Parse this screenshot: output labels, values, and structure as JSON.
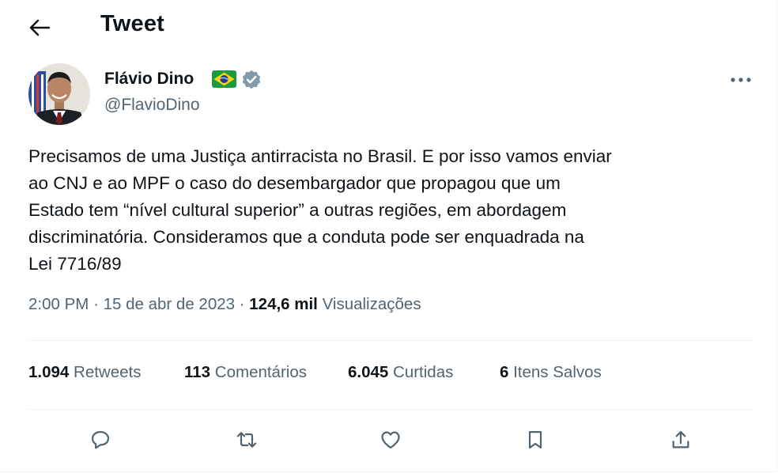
{
  "header": {
    "title": "Tweet",
    "back_icon": "arrow-left-icon"
  },
  "author": {
    "name": "Flávio Dino",
    "handle": "@FlavioDino",
    "flag_icon": "brazil-flag-icon",
    "verified_icon": "verified-badge-icon",
    "verified_color": "#829aab",
    "more_icon": "more-horizontal-icon"
  },
  "tweet": {
    "text_lines": [
      "Precisamos de uma Justiça antirracista no Brasil. E por isso vamos enviar",
      "ao CNJ e ao MPF o caso do desembargador que propagou que um",
      "Estado tem “nível cultural superior” a outras regiões, em abordagem",
      "discriminatória. Consideramos que a conduta pode ser enquadrada na",
      "Lei 7716/89"
    ],
    "time": "2:00 PM",
    "separator": "·",
    "date": "15 de abr de 2023",
    "views_count": "124,6 mil",
    "views_label": "Visualizações"
  },
  "stats": {
    "retweets": {
      "count": "1.094",
      "label": "Retweets"
    },
    "comments": {
      "count": "113",
      "label": "Comentários"
    },
    "likes": {
      "count": "6.045",
      "label": "Curtidas"
    },
    "saved": {
      "count": "6",
      "label": "Itens Salvos"
    }
  },
  "actions": {
    "reply_icon": "reply-icon",
    "retweet_icon": "retweet-icon",
    "like_icon": "heart-icon",
    "bookmark_icon": "bookmark-icon",
    "share_icon": "share-icon"
  },
  "colors": {
    "text_primary": "#0f1419",
    "text_secondary": "#536471",
    "divider": "#eff3f4"
  }
}
